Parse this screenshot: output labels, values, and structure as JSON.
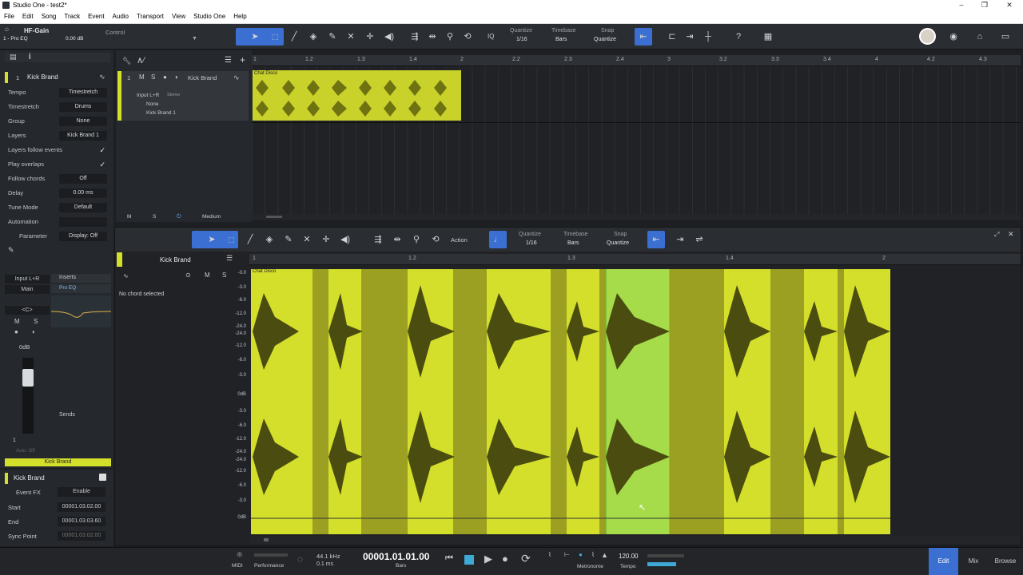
{
  "window": {
    "title": "Studio One - test2*",
    "btn_min": "–",
    "btn_max": "❐",
    "btn_close": "✕"
  },
  "menu": [
    "File",
    "Edit",
    "Song",
    "Track",
    "Event",
    "Audio",
    "Transport",
    "View",
    "Studio One",
    "Help"
  ],
  "toolbar": {
    "preset_name": "HF-Gain",
    "preset_sub": "1 - Pro EQ",
    "gain": "0.00 dB",
    "control_label": "Control",
    "iq": "IQ",
    "quantize_label": "Quantize",
    "quantize_value": "1/16",
    "timebase_label": "Timebase",
    "timebase_value": "Bars",
    "snap_label": "Snap",
    "snap_value": "Quantize",
    "help": "?"
  },
  "inspector": {
    "track_number": "1",
    "track_name": "Kick Brand",
    "rows": [
      {
        "k": "Tempo",
        "v": "Timestretch"
      },
      {
        "k": "Timestretch",
        "v": "Drums"
      },
      {
        "k": "Group",
        "v": "None"
      },
      {
        "k": "Layers",
        "v": "Kick Brand 1"
      },
      {
        "k": "Layers follow events",
        "v": ""
      },
      {
        "k": "Play overlaps",
        "v": ""
      },
      {
        "k": "Follow chords",
        "v": "Off"
      },
      {
        "k": "Delay",
        "v": "0.00 ms"
      },
      {
        "k": "Tune Mode",
        "v": "Default"
      },
      {
        "k": "Automation",
        "v": ""
      },
      {
        "k": "Parameter",
        "v": "Display: Off"
      }
    ],
    "check": "✓"
  },
  "track": {
    "number": "1",
    "m": "M",
    "s": "S",
    "name": "Kick Brand",
    "input": "Input L+R",
    "stereo": "Stereo",
    "none": "None",
    "layer": "Kick Brand 1",
    "event_name": "Chat Disco",
    "footer_m": "M",
    "footer_s": "S",
    "footer_size": "Medium"
  },
  "ruler_top": [
    "1",
    "1.2",
    "1.3",
    "1.4",
    "2",
    "2.2",
    "2.3",
    "2.4",
    "3",
    "3.2",
    "3.3",
    "3.4",
    "4",
    "4.2",
    "4.3"
  ],
  "editor": {
    "action": "Action",
    "quantize_label": "Quantize",
    "quantize_value": "1/16",
    "timebase_label": "Timebase",
    "timebase_value": "Bars",
    "snap_label": "Snap",
    "snap_value": "Quantize",
    "track_name": "Kick Brand",
    "m": "M",
    "s": "S",
    "no_chord": "No chord selected",
    "event_name": "Chat Disco",
    "ruler": [
      "1",
      "1.2",
      "1.3",
      "1.4",
      "2"
    ],
    "db_top": [
      "-0.0",
      "-3.0",
      "-6.0",
      "-12.0",
      "-24.0",
      "-24.0",
      "-12.0",
      "-6.0",
      "-3.0",
      "0dB"
    ],
    "db_bottom": [
      "-3.0",
      "-6.0",
      "-12.0",
      "-24.0",
      "-24.0",
      "-12.0",
      "-6.0",
      "-3.0",
      "0dB"
    ]
  },
  "channel": {
    "input": "Input L+R",
    "main": "Main",
    "pan": "<C>",
    "m": "M",
    "s": "S",
    "vol": "0dB",
    "inserts": "Inserts",
    "plugin": "Pro EQ",
    "sends": "Sends",
    "num": "1",
    "auto": "Auto: Off",
    "name": "Kick Brand"
  },
  "event_inspector": {
    "name": "Kick Brand",
    "fx": "Event FX",
    "enable": "Enable",
    "start_label": "Start",
    "start": "00001.03.02.00",
    "end_label": "End",
    "end": "00001.03.03.60",
    "sync_label": "Sync Point",
    "sync": "00001.03.02.00"
  },
  "transport": {
    "midi": "MIDI",
    "performance": "Performance",
    "rate": "44.1 kHz",
    "latency": "0.1 ms",
    "time": "00001.01.01.00",
    "time_unit": "Bars",
    "metronome": "Metronome",
    "tempo_value": "120.00",
    "tempo_label": "Tempo",
    "edit": "Edit",
    "mix": "Mix",
    "browse": "Browse"
  },
  "colors": {
    "event": "#d4df2c",
    "event_dark": "#9ba023",
    "selected": "#a6dc4a",
    "accent": "#3b6fd1"
  }
}
